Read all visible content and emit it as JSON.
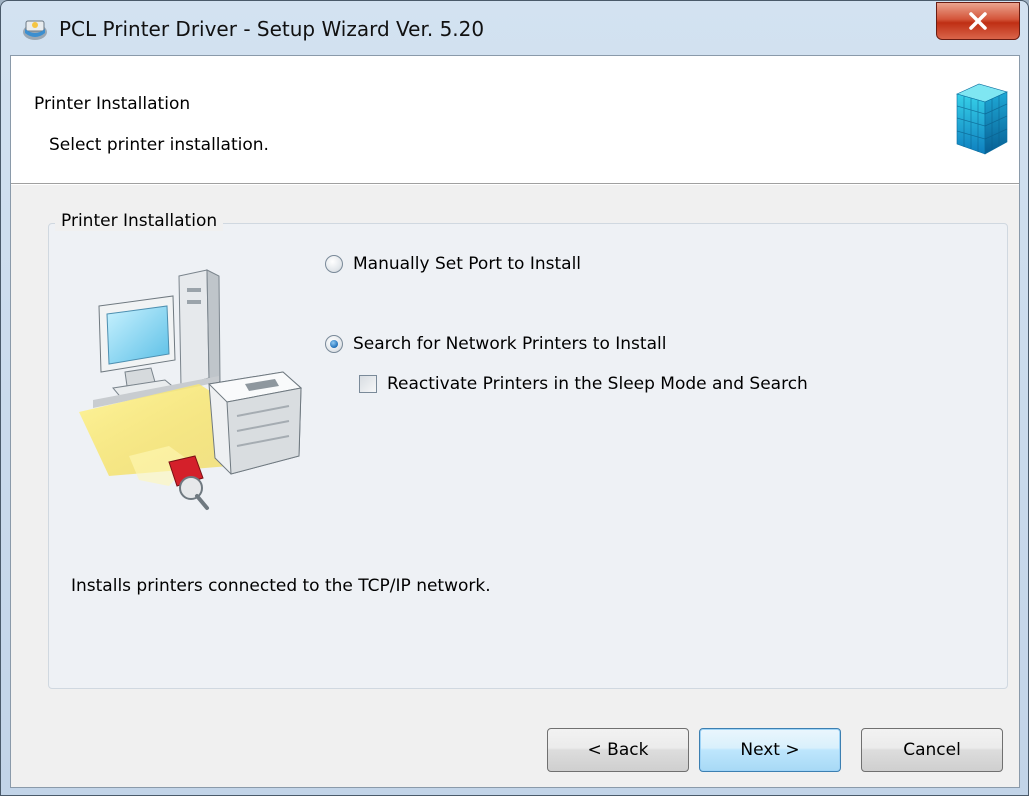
{
  "window": {
    "title": "PCL Printer Driver - Setup Wizard Ver. 5.20",
    "title_icon": "printer-driver-icon",
    "close_icon": "close-x-icon"
  },
  "header": {
    "title": "Printer Installation",
    "subtitle": "Select printer installation.",
    "logo_icon": "blue-cube-icon"
  },
  "group": {
    "legend": "Printer Installation",
    "illustration_icon": "computer-network-printer-icon"
  },
  "options": {
    "manual": {
      "label": "Manually Set Port to Install",
      "checked": false
    },
    "search": {
      "label": "Search for Network Printers to Install",
      "checked": true
    },
    "reactivate": {
      "label": "Reactivate Printers in the Sleep Mode and Search",
      "checked": false
    }
  },
  "description": "Installs printers connected to the TCP/IP network.",
  "buttons": {
    "back": "< Back",
    "next": "Next >",
    "cancel": "Cancel"
  },
  "colors": {
    "close_button": "#c8391c",
    "default_button_border": "#3c7fb1",
    "radio_selected": "#1f6fb8"
  }
}
